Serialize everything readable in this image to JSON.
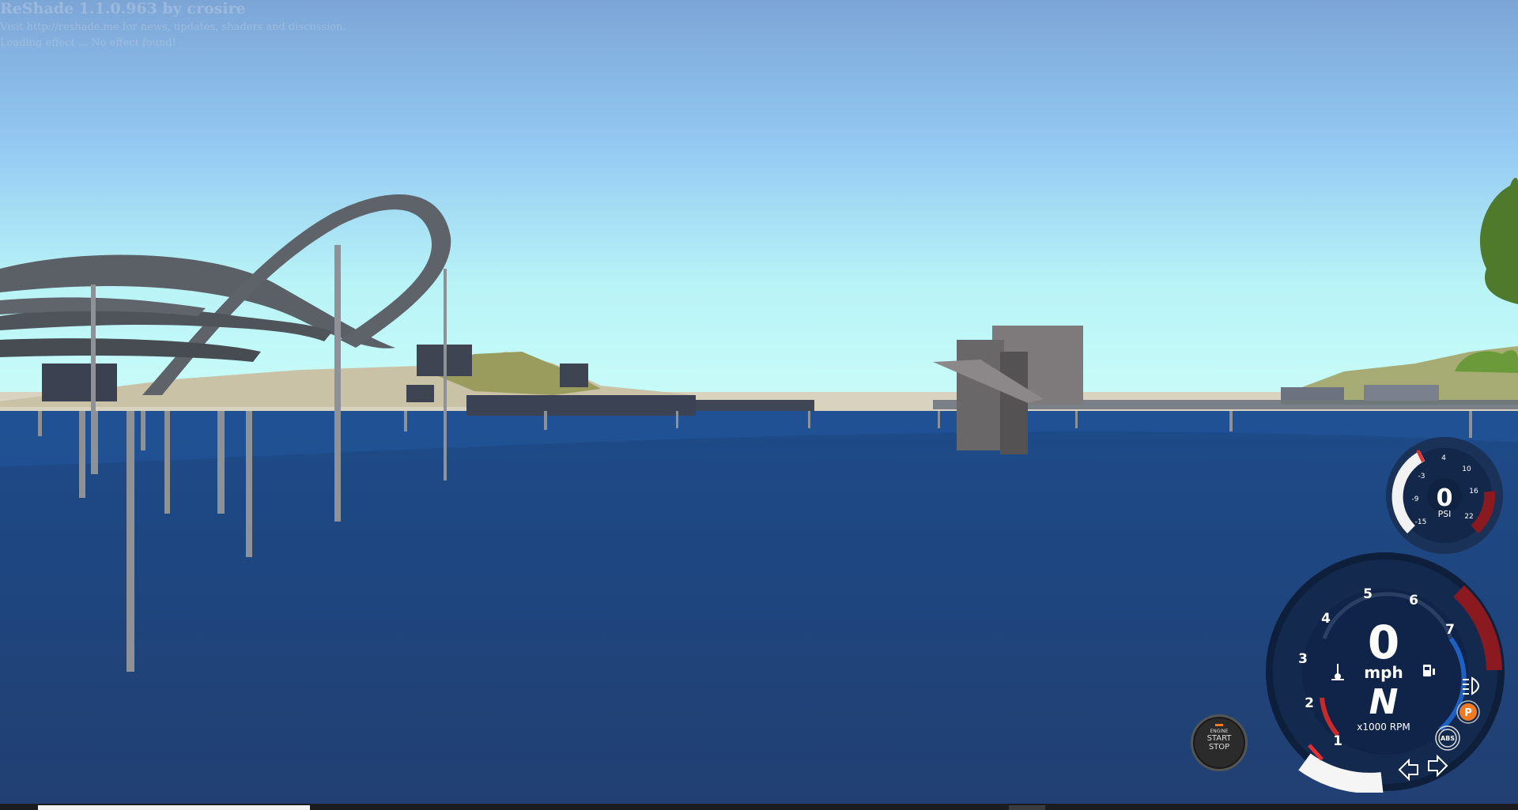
{
  "overlay": {
    "line1": "ReShade 1.1.0.963 by crosire",
    "line2": "Visit http://reshade.me for news, updates, shaders and discussion.",
    "line3": "Loading effect ... No effect found!"
  },
  "boost_gauge": {
    "value": "0",
    "unit": "PSI",
    "ticks": [
      "-15",
      "-9",
      "-3",
      "4",
      "10",
      "16",
      "22"
    ]
  },
  "speedometer": {
    "speed": "0",
    "speed_unit": "mph",
    "gear": "N",
    "rpm_label": "x1000 RPM",
    "rpm_ticks": [
      "1",
      "2",
      "3",
      "4",
      "5",
      "6",
      "7"
    ]
  },
  "engine_button": {
    "line1": "ENGINE",
    "line2": "START",
    "line3": "STOP"
  },
  "indicators": {
    "parking": "P",
    "abs": "ABS"
  },
  "colors": {
    "sky_top": "#7fa9d9",
    "sky_horizon": "#c4fbf9",
    "water": "#1e4a86",
    "gauge_bg": "#14284a",
    "redline": "#8a1a1f",
    "parking_badge": "#f07a23"
  }
}
